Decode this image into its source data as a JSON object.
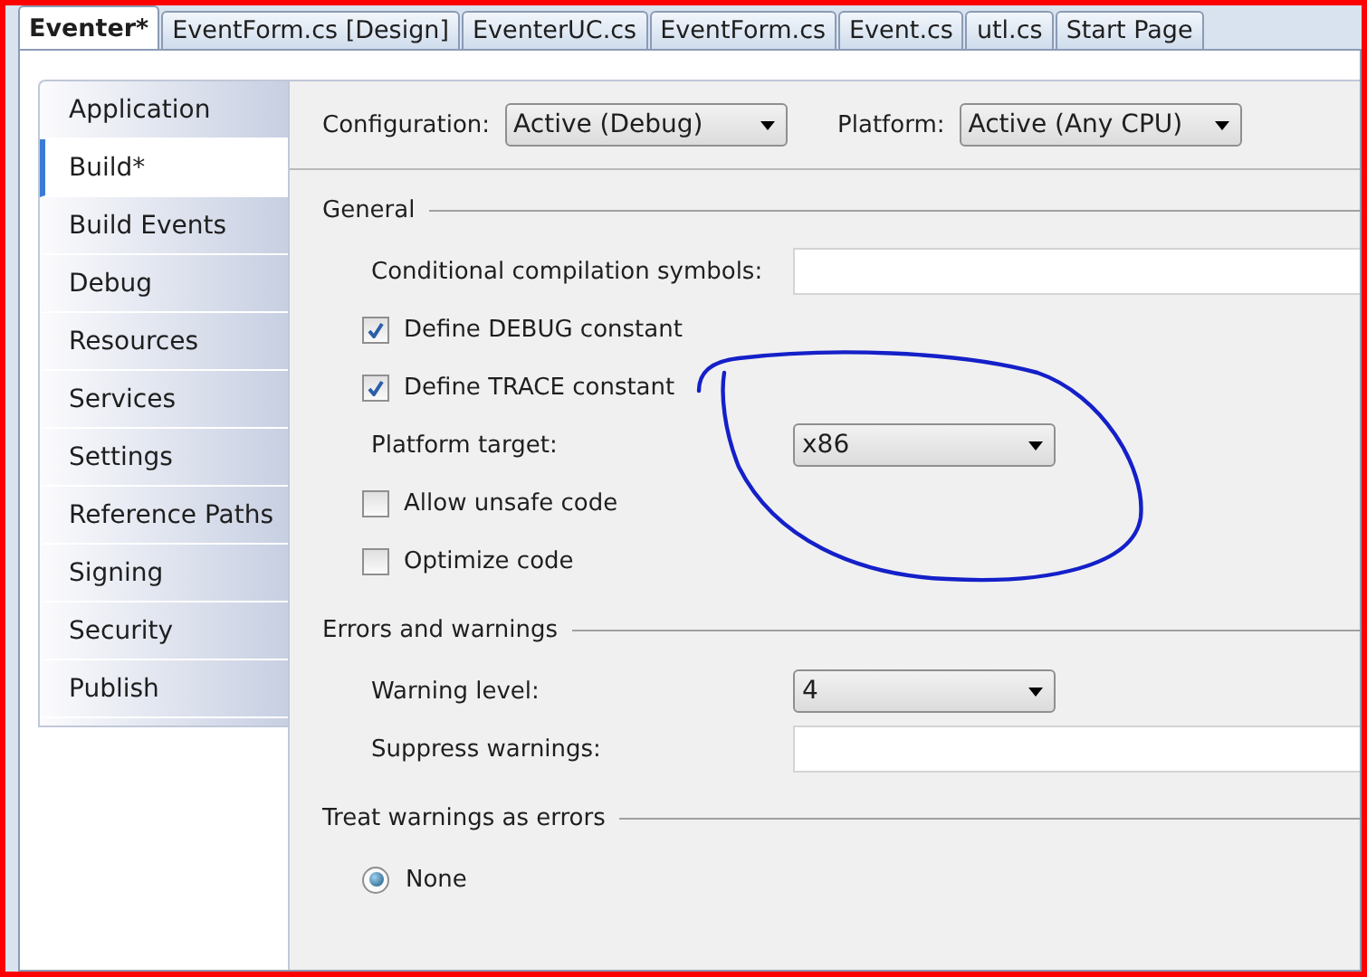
{
  "tabs": [
    {
      "label": "Eventer*",
      "selected": true
    },
    {
      "label": "EventForm.cs [Design]",
      "selected": false
    },
    {
      "label": "EventerUC.cs",
      "selected": false
    },
    {
      "label": "EventForm.cs",
      "selected": false
    },
    {
      "label": "Event.cs",
      "selected": false
    },
    {
      "label": "utl.cs",
      "selected": false
    },
    {
      "label": "Start Page",
      "selected": false
    }
  ],
  "sidebar": {
    "items": [
      {
        "label": "Application",
        "selected": false
      },
      {
        "label": "Build*",
        "selected": true
      },
      {
        "label": "Build Events",
        "selected": false
      },
      {
        "label": "Debug",
        "selected": false
      },
      {
        "label": "Resources",
        "selected": false
      },
      {
        "label": "Services",
        "selected": false
      },
      {
        "label": "Settings",
        "selected": false
      },
      {
        "label": "Reference Paths",
        "selected": false
      },
      {
        "label": "Signing",
        "selected": false
      },
      {
        "label": "Security",
        "selected": false
      },
      {
        "label": "Publish",
        "selected": false
      }
    ]
  },
  "toolbar": {
    "configuration": {
      "label": "Configuration:",
      "value": "Active (Debug)"
    },
    "platform": {
      "label": "Platform:",
      "value": "Active (Any CPU)"
    }
  },
  "sections": [
    {
      "title": "General",
      "rows": [
        {
          "kind": "text",
          "label": "Conditional compilation symbols:"
        },
        {
          "kind": "checkbox",
          "label": "Define DEBUG constant",
          "checked": true
        },
        {
          "kind": "checkbox",
          "label": "Define TRACE constant",
          "checked": true
        },
        {
          "kind": "dropdown",
          "label": "Platform target:",
          "value": "x86"
        },
        {
          "kind": "checkbox",
          "label": "Allow unsafe code",
          "checked": false
        },
        {
          "kind": "checkbox",
          "label": "Optimize code",
          "checked": false
        }
      ]
    },
    {
      "title": "Errors and warnings",
      "rows": [
        {
          "kind": "dropdown",
          "label": "Warning level:",
          "value": "4"
        },
        {
          "kind": "text",
          "label": "Suppress warnings:"
        }
      ]
    },
    {
      "title": "Treat warnings as errors",
      "rows": [
        {
          "kind": "radio",
          "label": "None",
          "selected": true
        }
      ]
    }
  ]
}
